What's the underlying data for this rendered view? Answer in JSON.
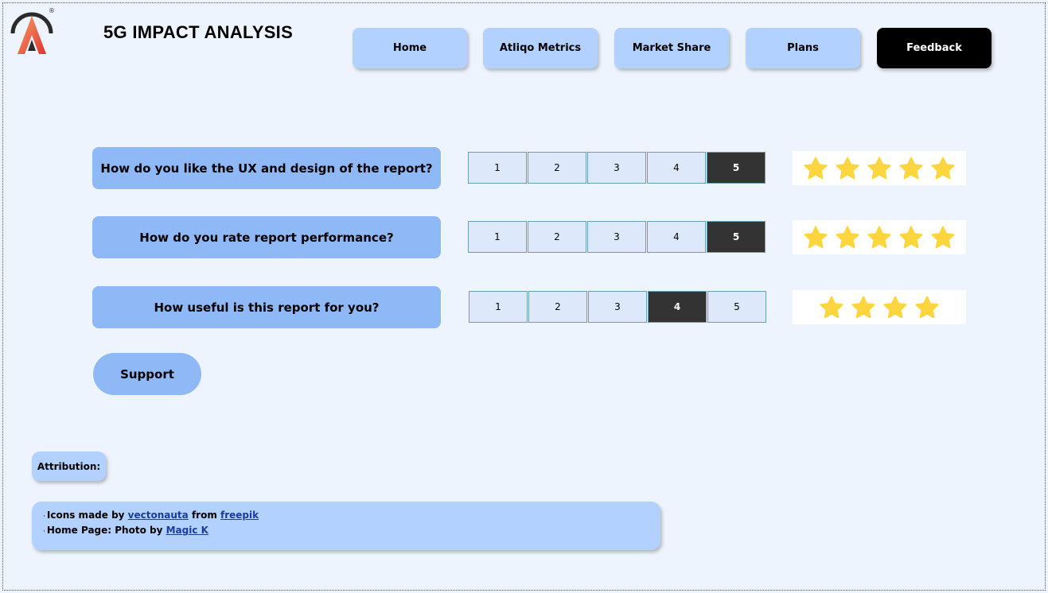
{
  "header": {
    "title": "5G IMPACT ANALYSIS",
    "logo": "atliqo-logo",
    "registered_mark": "®"
  },
  "nav": [
    {
      "label": "Home",
      "active": false
    },
    {
      "label": "Atliqo Metrics",
      "active": false
    },
    {
      "label": "Market Share",
      "active": false
    },
    {
      "label": "Plans",
      "active": false
    },
    {
      "label": "Feedback",
      "active": true
    }
  ],
  "questions": [
    {
      "text": "How do you like the UX and design of the report?",
      "options": [
        "1",
        "2",
        "3",
        "4",
        "5"
      ],
      "selected": 5,
      "stars": 5
    },
    {
      "text": "How do you rate report performance?",
      "options": [
        "1",
        "2",
        "3",
        "4",
        "5"
      ],
      "selected": 5,
      "stars": 5
    },
    {
      "text": "How useful is this report for you?",
      "options": [
        "1",
        "2",
        "3",
        "4",
        "5"
      ],
      "selected": 4,
      "stars": 4
    }
  ],
  "support": {
    "label": "Support"
  },
  "attribution": {
    "label": "Attribution:",
    "line1": {
      "prefix": "Icons made by",
      "author": "vectonauta",
      "middle": "from",
      "source": "freepik"
    },
    "line2": {
      "prefix": "Home Page: Photo by",
      "author": "Magic K"
    }
  },
  "colors": {
    "background": "#eef4fd",
    "nav_button": "#b3d1ff",
    "question_box": "#8fb8f6",
    "selected_cell": "#333333",
    "star": "#fcd53f"
  }
}
